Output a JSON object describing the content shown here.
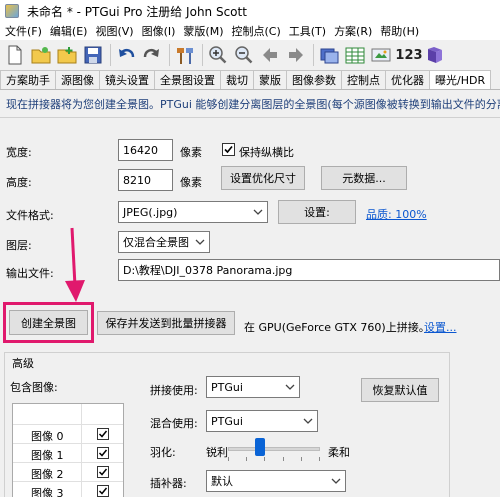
{
  "window": {
    "title": "未命名 * - PTGui Pro 注册给 John Scott"
  },
  "menu": [
    "文件(F)",
    "编辑(E)",
    "视图(V)",
    "图像(I)",
    "蒙版(M)",
    "控制点(C)",
    "工具(T)",
    "方案(R)",
    "帮助(H)"
  ],
  "toolbar": {
    "zoom_label": "123"
  },
  "tabs": [
    "方案助手",
    "源图像",
    "镜头设置",
    "全景图设置",
    "裁切",
    "蒙版",
    "图像参数",
    "控制点",
    "优化器",
    "曝光/HDR"
  ],
  "info_text": "现在拼接器将为您创建全景图。PTGui 能够创建分离图层的全景图(每个源图像被转换到输出文件的分离",
  "form": {
    "width_label": "宽度:",
    "width_value": "16420",
    "width_unit": "像素",
    "keep_ratio_label": "保持纵横比",
    "height_label": "高度:",
    "height_value": "8210",
    "height_unit": "像素",
    "optimize_btn": "设置优化尺寸",
    "metadata_btn": "元数据...",
    "format_label": "文件格式:",
    "format_value": "JPEG(.jpg)",
    "settings_btn": "设置:",
    "quality_link": "品质: 100%",
    "layers_label": "图层:",
    "layers_value": "仅混合全景图",
    "output_label": "输出文件:",
    "output_value": "D:\\教程\\DJI_0378 Panorama.jpg"
  },
  "actions": {
    "create_btn": "创建全景图",
    "batch_btn": "保存并发送到批量拼接器",
    "gpu_text": "在 GPU(GeForce GTX 760)上拼接。",
    "gpu_link": "设置..."
  },
  "advanced": {
    "group_title": "高级",
    "include_label": "包含图像:",
    "images": [
      "图像 0",
      "图像 1",
      "图像 2",
      "图像 3"
    ],
    "stitcher_label": "拼接使用:",
    "stitcher_value": "PTGui",
    "blend_label": "混合使用:",
    "blend_value": "PTGui",
    "feather_label": "羽化:",
    "feather_sharp": "锐利",
    "feather_soft": "柔和",
    "feather_level": 0.35,
    "interp_label": "插补器:",
    "interp_value": "默认",
    "restore_btn": "恢复默认值"
  },
  "colors": {
    "highlight": "#e0196d",
    "link": "#0b57d0",
    "slider_thumb": "#0a64d6"
  }
}
